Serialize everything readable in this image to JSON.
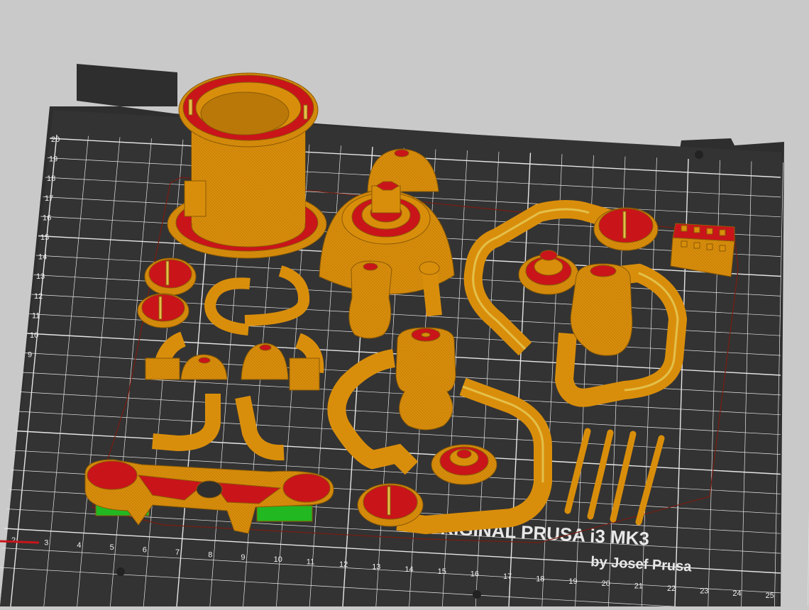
{
  "scene": {
    "background_color": "#c9c9c9",
    "bed_color": "#2e2e2e",
    "grid_color": "#e6e6e6",
    "part_color": "#d98e0b",
    "top_layer_color": "#c9141a",
    "infill_color": "#e3c04a",
    "support_color": "#22b822",
    "skirt_color": "#7a1c10"
  },
  "bed": {
    "logo_line1": "ORIGINAL PRUSA i3  MK3",
    "logo_line2": "by Josef Prusa",
    "x_axis_labels": [
      "2",
      "3",
      "4",
      "5",
      "6",
      "7",
      "8",
      "9",
      "10",
      "11",
      "12",
      "13",
      "14",
      "15",
      "16",
      "17",
      "18",
      "19",
      "20",
      "21",
      "22",
      "23",
      "24",
      "25"
    ],
    "y_axis_labels": [
      "20",
      "19",
      "18",
      "17",
      "16",
      "15",
      "14",
      "13",
      "12",
      "11",
      "10",
      "9"
    ]
  }
}
